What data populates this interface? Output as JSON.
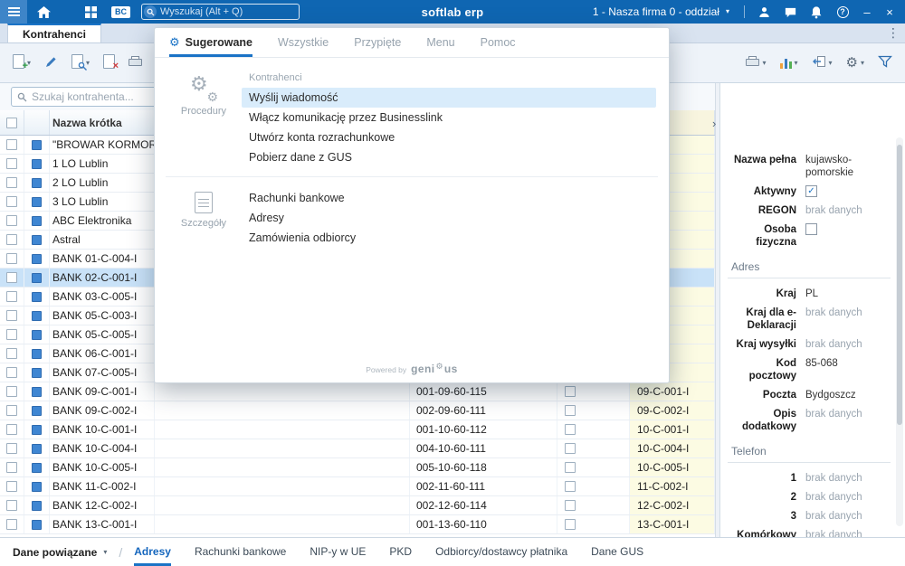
{
  "topbar": {
    "app_title": "softlab erp",
    "search_placeholder": "Wyszukaj (Alt + Q)",
    "bc_badge": "BC",
    "company": "1 - Nasza firma 0 - oddział",
    "minimize": "–",
    "close": "×"
  },
  "module_tab": "Kontrahenci",
  "toolbar": {
    "left_buttons": [
      {
        "icon": "add-document-icon",
        "dropdown": true
      },
      {
        "icon": "edit-icon",
        "dropdown": false
      },
      {
        "icon": "view-document-icon",
        "dropdown": true
      },
      {
        "icon": "delete-document-icon",
        "dropdown": false
      },
      {
        "icon": "print-icon",
        "dropdown": false
      }
    ],
    "right_buttons": [
      {
        "icon": "print-icon",
        "dropdown": true
      },
      {
        "icon": "chart-icon",
        "dropdown": true
      },
      {
        "icon": "import-icon",
        "dropdown": true
      },
      {
        "icon": "settings-icon",
        "dropdown": true
      },
      {
        "icon": "filter-icon",
        "dropdown": false
      }
    ]
  },
  "list": {
    "search_placeholder": "Szukaj kontrahenta...",
    "column_header": "Nazwa krótka",
    "selected_index": 7,
    "rows": [
      {
        "name": "\"BROWAR KORMORAN",
        "number": "",
        "code": ""
      },
      {
        "name": "1 LO Lublin",
        "number": "",
        "code": ""
      },
      {
        "name": "2 LO Lublin",
        "number": "",
        "code": ""
      },
      {
        "name": "3 LO Lublin",
        "number": "",
        "code": ""
      },
      {
        "name": "ABC Elektronika",
        "number": "",
        "code": ""
      },
      {
        "name": "Astral",
        "number": "",
        "code": ""
      },
      {
        "name": "BANK 01-C-004-I",
        "number": "",
        "code": ""
      },
      {
        "name": "BANK 02-C-001-I",
        "number": "",
        "code": ""
      },
      {
        "name": "BANK 03-C-005-I",
        "number": "",
        "code": ""
      },
      {
        "name": "BANK 05-C-003-I",
        "number": "",
        "code": ""
      },
      {
        "name": "BANK 05-C-005-I",
        "number": "",
        "code": ""
      },
      {
        "name": "BANK 06-C-001-I",
        "number": "",
        "code": ""
      },
      {
        "name": "BANK 07-C-005-I",
        "number": "",
        "code": ""
      },
      {
        "name": "BANK 09-C-001-I",
        "number": "001-09-60-115",
        "code": "09-C-001-I"
      },
      {
        "name": "BANK 09-C-002-I",
        "number": "002-09-60-111",
        "code": "09-C-002-I"
      },
      {
        "name": "BANK 10-C-001-I",
        "number": "001-10-60-112",
        "code": "10-C-001-I"
      },
      {
        "name": "BANK 10-C-004-I",
        "number": "004-10-60-111",
        "code": "10-C-004-I"
      },
      {
        "name": "BANK 10-C-005-I",
        "number": "005-10-60-118",
        "code": "10-C-005-I"
      },
      {
        "name": "BANK 11-C-002-I",
        "number": "002-11-60-111",
        "code": "11-C-002-I"
      },
      {
        "name": "BANK 12-C-002-I",
        "number": "002-12-60-114",
        "code": "12-C-002-I"
      },
      {
        "name": "BANK 13-C-001-I",
        "number": "001-13-60-110",
        "code": "13-C-001-I"
      }
    ]
  },
  "overlay": {
    "tabs": [
      {
        "label": "Sugerowane",
        "active": true
      },
      {
        "label": "Wszystkie",
        "active": false
      },
      {
        "label": "Przypięte",
        "active": false
      },
      {
        "label": "Menu",
        "active": false
      },
      {
        "label": "Pomoc",
        "active": false
      }
    ],
    "groups": [
      {
        "rail_label": "Procedury",
        "rail_icon": "gears-icon",
        "header": "Kontrahenci",
        "items": [
          {
            "label": "Wyślij wiadomość",
            "selected": true
          },
          {
            "label": "Włącz komunikację przez Businesslink",
            "selected": false
          },
          {
            "label": "Utwórz konta rozrachunkowe",
            "selected": false
          },
          {
            "label": "Pobierz dane z GUS",
            "selected": false
          }
        ]
      },
      {
        "rail_label": "Szczegóły",
        "rail_icon": "details-icon",
        "header": "",
        "items": [
          {
            "label": "Rachunki bankowe",
            "selected": false
          },
          {
            "label": "Adresy",
            "selected": false
          },
          {
            "label": "Zamówienia odbiorcy",
            "selected": false
          }
        ]
      }
    ],
    "powered_by": "Powered by",
    "brand_prefix": "geni",
    "brand_suffix": "us"
  },
  "details_panel": {
    "sections": [
      {
        "title": "",
        "fields": [
          {
            "label": "Nazwa pełna",
            "value": "kujawsko-pomorskie",
            "type": "text"
          },
          {
            "label": "Aktywny",
            "type": "checkbox",
            "checked": true
          },
          {
            "label": "REGON",
            "value": "brak danych",
            "type": "empty"
          },
          {
            "label": "Osoba fizyczna",
            "type": "checkbox",
            "checked": false
          }
        ]
      },
      {
        "title": "Adres",
        "fields": [
          {
            "label": "Kraj",
            "value": "PL",
            "type": "text"
          },
          {
            "label": "Kraj dla e-Deklaracji",
            "value": "brak danych",
            "type": "empty"
          },
          {
            "label": "Kraj wysyłki",
            "value": "brak danych",
            "type": "empty"
          },
          {
            "label": "Kod pocztowy",
            "value": "85-068",
            "type": "text"
          },
          {
            "label": "Poczta",
            "value": "Bydgoszcz",
            "type": "text"
          },
          {
            "label": "Opis dodatkowy",
            "value": "brak danych",
            "type": "empty"
          }
        ]
      },
      {
        "title": "Telefon",
        "fields": [
          {
            "label": "1",
            "value": "brak danych",
            "type": "empty"
          },
          {
            "label": "2",
            "value": "brak danych",
            "type": "empty"
          },
          {
            "label": "3",
            "value": "brak danych",
            "type": "empty"
          },
          {
            "label": "Komórkowy",
            "value": "brak danych",
            "type": "empty"
          }
        ]
      }
    ]
  },
  "bottom_bar": {
    "related_label": "Dane powiązane",
    "tabs": [
      {
        "label": "Adresy",
        "active": true
      },
      {
        "label": "Rachunki bankowe",
        "active": false
      },
      {
        "label": "NIP-y w UE",
        "active": false
      },
      {
        "label": "PKD",
        "active": false
      },
      {
        "label": "Odbiorcy/dostawcy płatnika",
        "active": false
      },
      {
        "label": "Dane GUS",
        "active": false
      }
    ]
  },
  "colors": {
    "topbar": "#0f66b2",
    "accent": "#1a73c6",
    "selection": "#c9e2f8",
    "yellow_column": "#fcfbe3",
    "tabbar_bg": "#d9e3f0",
    "muted_text": "#9aa5b0"
  }
}
